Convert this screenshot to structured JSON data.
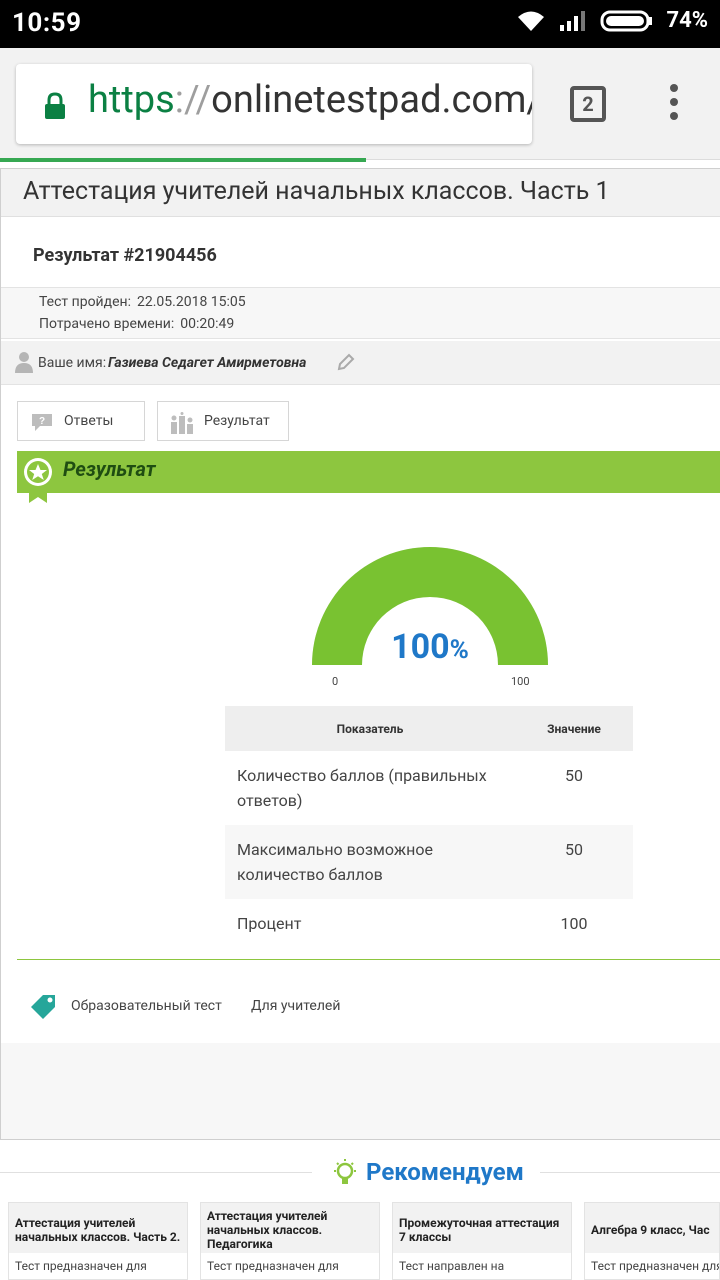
{
  "status_bar": {
    "time": "10:59",
    "battery": "74%"
  },
  "browser": {
    "url_scheme": "https",
    "url_sep": "://",
    "url_host": "onlinetestpad.com/",
    "tab_count": "2"
  },
  "page": {
    "title": "Аттестация учителей начальных классов. Часть 1",
    "result_id": "Результат #21904456",
    "test_passed_label": "Тест пройден:",
    "test_passed_value": "22.05.2018 15:05",
    "time_spent_label": "Потрачено времени:",
    "time_spent_value": "00:20:49",
    "name_label": "Ваше имя:",
    "name_value": "Газиева Седагет Амирметовна"
  },
  "tabs": [
    {
      "label": "Ответы",
      "icon": "question-bubble-icon"
    },
    {
      "label": "Результат",
      "icon": "bar-chart-icon"
    }
  ],
  "result_section": {
    "title": "Результат",
    "gauge": {
      "value": 100,
      "display": "100",
      "unit": "%",
      "min": "0",
      "max": "100"
    }
  },
  "table": {
    "headers": [
      "Показатель",
      "Значение"
    ],
    "rows": [
      {
        "name_line1": "Количество баллов (правильных",
        "name_line2": "ответов)",
        "value": "50"
      },
      {
        "name_line1": "Максимально возможное",
        "name_line2": "количество баллов",
        "value": "50"
      },
      {
        "name_line1": "Процент",
        "name_line2": "",
        "value": "100"
      }
    ]
  },
  "tags": [
    "Образовательный тест",
    "Для учителей"
  ],
  "recommend": {
    "title": "Рекомендуем",
    "cards": [
      {
        "title": "Аттестация учителей начальных классов. Часть 2.",
        "desc": "Тест предназначен для"
      },
      {
        "title": "Аттестация учителей начальных классов. Педагогика",
        "desc": "Тест предназначен для"
      },
      {
        "title": "Промежуточная аттестация 7 классы",
        "desc": "Тест направлен на"
      },
      {
        "title": "Алгебра 9 класс, Час",
        "desc": "Тест предназначен для"
      }
    ]
  },
  "colors": {
    "accent_green": "#8dc63f",
    "gauge_green": "#79c231",
    "link_blue": "#1f78c8",
    "secure_green": "#0b8043"
  }
}
